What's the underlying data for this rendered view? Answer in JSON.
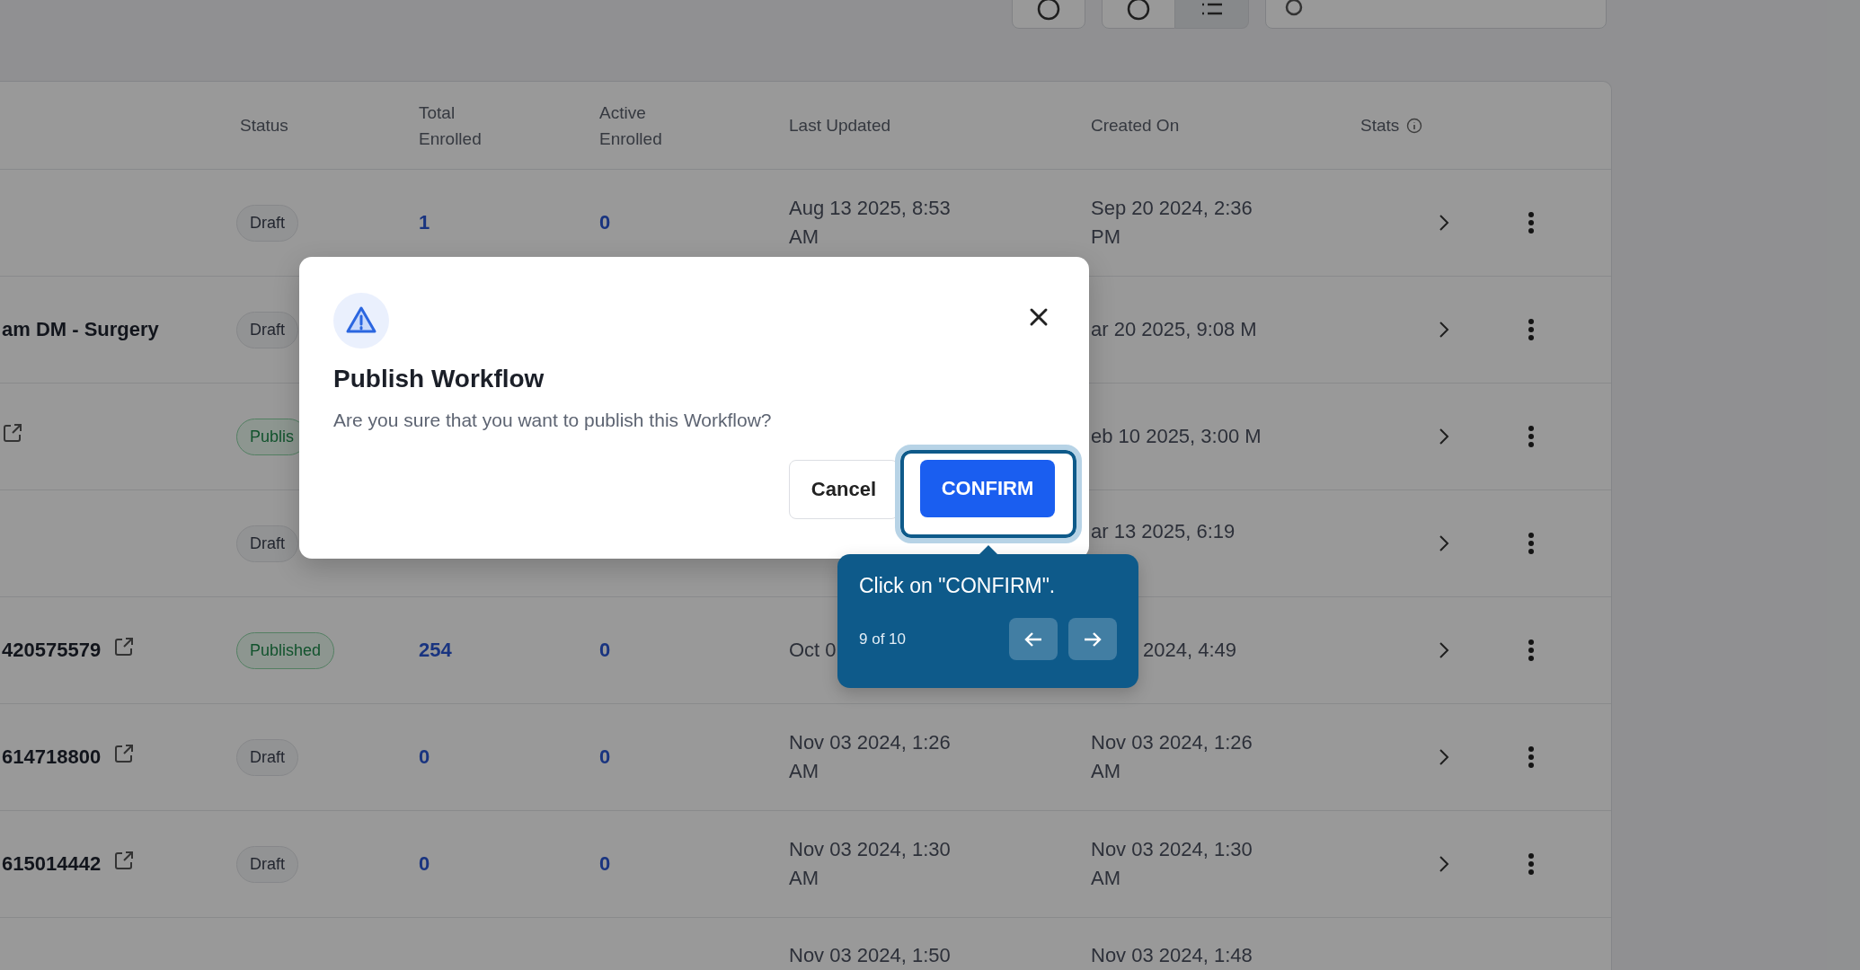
{
  "toolbar": {
    "view_buttons": [
      {
        "selected": false
      },
      {
        "selected": true
      }
    ]
  },
  "table": {
    "columns": [
      "Status",
      "Total Enrolled",
      "Active Enrolled",
      "Last Updated",
      "Created On",
      "Stats"
    ],
    "rows": [
      {
        "link": false,
        "status": {
          "label": "Draft",
          "kind": "draft"
        },
        "total": "1",
        "active": "0",
        "last_updated": "Aug 13 2025, 8:53 AM",
        "created_on": "Sep 20 2024, 2:36 PM"
      },
      {
        "name": "am DM - Surgery",
        "link": false,
        "status": {
          "label": "Draft",
          "kind": "draft"
        },
        "created_on": "ar 20 2025, 9:08 M"
      },
      {
        "link": true,
        "status": {
          "label": "Publis",
          "kind": "published"
        },
        "created_on": "eb 10 2025, 3:00 M"
      },
      {
        "link": false,
        "status": {
          "label": "Draft",
          "kind": "draft"
        },
        "created_on": "ar 13 2025, 6:19"
      },
      {
        "name": "420575579",
        "link": true,
        "status": {
          "label": "Published",
          "kind": "published"
        },
        "total": "254",
        "active": "0",
        "last_updated": "Oct 0",
        "created_on": "2024, 4:49"
      },
      {
        "name": "614718800",
        "link": true,
        "status": {
          "label": "Draft",
          "kind": "draft"
        },
        "total": "0",
        "active": "0",
        "last_updated": "Nov 03 2024, 1:26 AM",
        "created_on": "Nov 03 2024, 1:26 AM"
      },
      {
        "name": "615014442",
        "link": true,
        "status": {
          "label": "Draft",
          "kind": "draft"
        },
        "total": "0",
        "active": "0",
        "last_updated": "Nov 03 2024, 1:30 AM",
        "created_on": "Nov 03 2024, 1:30 AM"
      },
      {
        "link": false,
        "last_updated": "Nov 03 2024, 1:50",
        "created_on": "Nov 03 2024, 1:48"
      }
    ]
  },
  "dialog": {
    "title": "Publish Workflow",
    "message": "Are you sure that you want to publish this Workflow?",
    "buttons": [
      "Cancel",
      "CONFIRM"
    ]
  },
  "tour": {
    "text": "Click on \"CONFIRM\".",
    "step": "9 of 10"
  }
}
